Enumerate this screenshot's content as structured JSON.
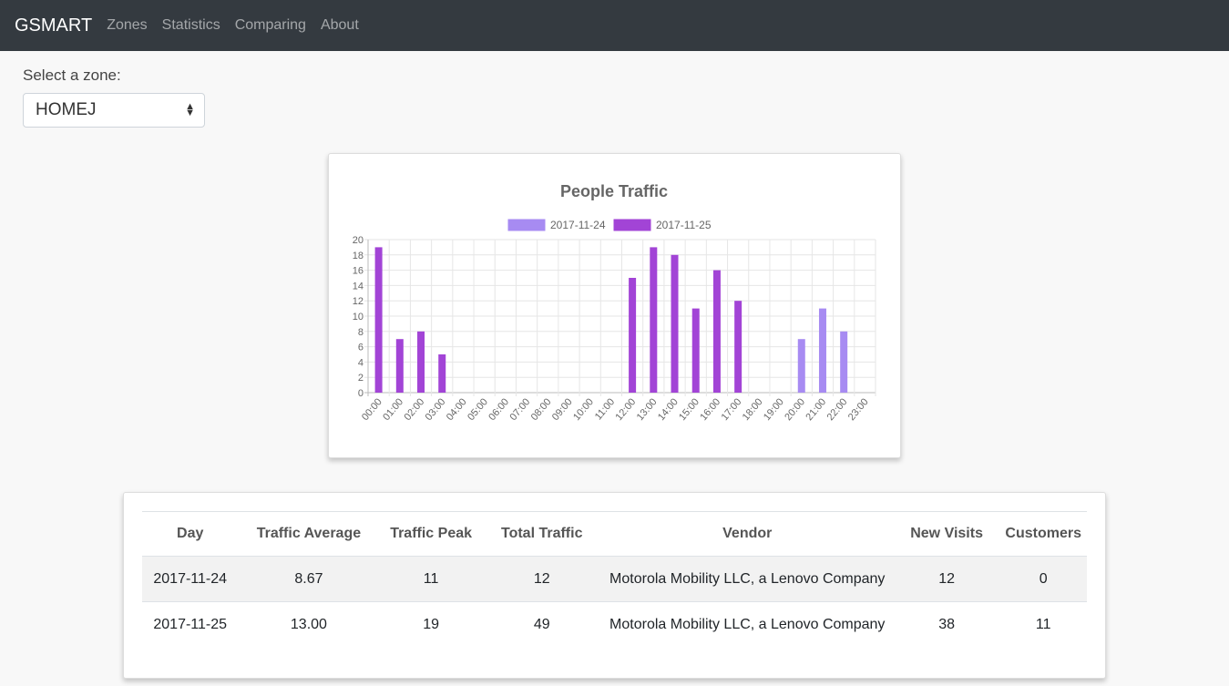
{
  "nav": {
    "brand": "GSMART",
    "links": [
      "Zones",
      "Statistics",
      "Comparing",
      "About"
    ]
  },
  "zone": {
    "label": "Select a zone:",
    "selected": "HOMEJ"
  },
  "chart_data": {
    "type": "bar",
    "title": "People Traffic",
    "categories": [
      "00:00",
      "01:00",
      "02:00",
      "03:00",
      "04:00",
      "05:00",
      "06:00",
      "07:00",
      "08:00",
      "09:00",
      "10:00",
      "11:00",
      "12:00",
      "13:00",
      "14:00",
      "15:00",
      "16:00",
      "17:00",
      "18:00",
      "19:00",
      "20:00",
      "21:00",
      "22:00",
      "23:00"
    ],
    "series": [
      {
        "name": "2017-11-24",
        "color": "#a78bf2",
        "values": [
          0,
          0,
          0,
          0,
          0,
          0,
          0,
          0,
          0,
          0,
          0,
          0,
          0,
          0,
          0,
          0,
          0,
          0,
          0,
          0,
          7,
          11,
          8,
          0
        ]
      },
      {
        "name": "2017-11-25",
        "color": "#a244d6",
        "values": [
          19,
          7,
          8,
          5,
          0,
          0,
          0,
          0,
          0,
          0,
          0,
          0,
          15,
          19,
          18,
          11,
          16,
          12,
          0,
          0,
          0,
          0,
          0,
          0
        ]
      }
    ],
    "ylim": [
      0,
      20
    ],
    "yticks": [
      0,
      2,
      4,
      6,
      8,
      10,
      12,
      14,
      16,
      18,
      20
    ],
    "legend": "top",
    "grid": true
  },
  "table": {
    "headers": [
      "Day",
      "Traffic Average",
      "Traffic Peak",
      "Total Traffic",
      "Vendor",
      "New Visits",
      "Customers"
    ],
    "rows": [
      [
        "2017-11-24",
        "8.67",
        "11",
        "12",
        "Motorola Mobility LLC, a Lenovo Company",
        "12",
        "0"
      ],
      [
        "2017-11-25",
        "13.00",
        "19",
        "49",
        "Motorola Mobility LLC, a Lenovo Company",
        "38",
        "11"
      ]
    ]
  }
}
